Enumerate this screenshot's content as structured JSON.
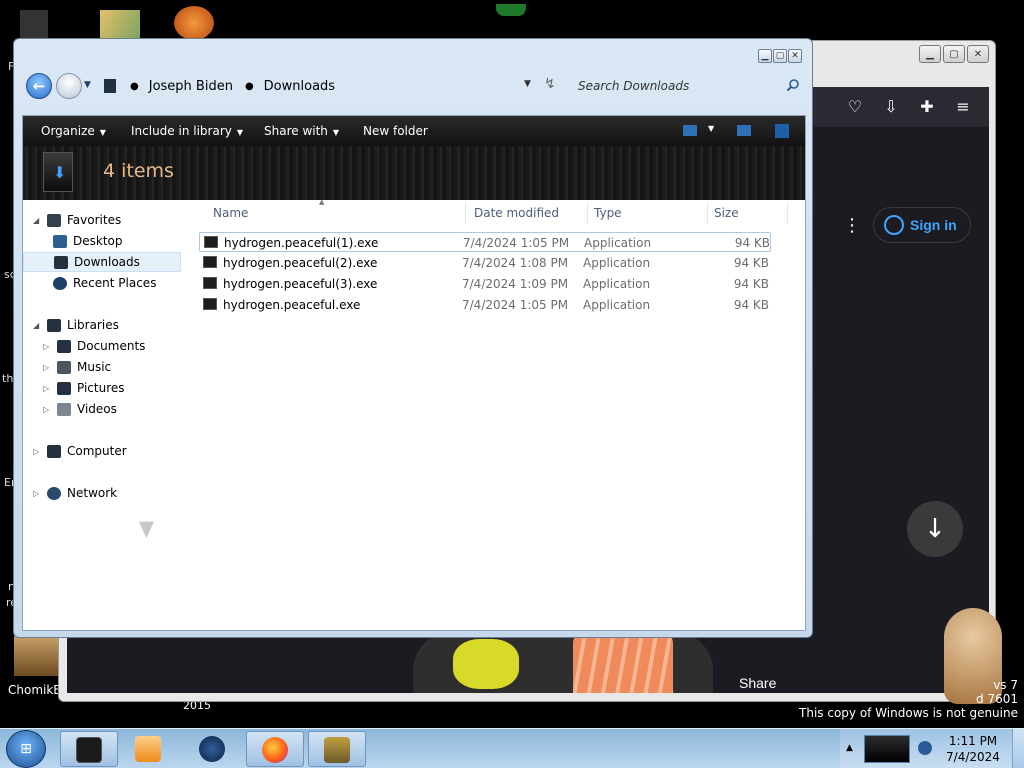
{
  "explorer": {
    "address": {
      "crumbs": [
        "Joseph Biden",
        "Downloads"
      ]
    },
    "search": {
      "placeholder": "Search Downloads"
    },
    "commands": {
      "organize": "Organize",
      "include": "Include in library",
      "share": "Share with",
      "new_folder": "New folder"
    },
    "details": {
      "count": "4 items"
    },
    "nav": {
      "favorites": "Favorites",
      "desktop": "Desktop",
      "downloads": "Downloads",
      "recent": "Recent Places",
      "libraries": "Libraries",
      "documents": "Documents",
      "music": "Music",
      "pictures": "Pictures",
      "videos": "Videos",
      "computer": "Computer",
      "network": "Network"
    },
    "columns": {
      "name": "Name",
      "date": "Date modified",
      "type": "Type",
      "size": "Size"
    },
    "files": [
      {
        "name": "hydrogen.peaceful(1).exe",
        "date": "7/4/2024 1:05 PM",
        "type": "Application",
        "size": "94 KB"
      },
      {
        "name": "hydrogen.peaceful(2).exe",
        "date": "7/4/2024 1:08 PM",
        "type": "Application",
        "size": "94 KB"
      },
      {
        "name": "hydrogen.peaceful(3).exe",
        "date": "7/4/2024 1:09 PM",
        "type": "Application",
        "size": "94 KB"
      },
      {
        "name": "hydrogen.peaceful.exe",
        "date": "7/4/2024 1:05 PM",
        "type": "Application",
        "size": "94 KB"
      }
    ]
  },
  "browser": {
    "sign_in": "Sign in",
    "share": "Share"
  },
  "desktop": {
    "icon_label": "ChomikB",
    "year": "2015",
    "watermark_line1": "vs 7",
    "watermark_line2": "d 7601",
    "watermark_line3": "This copy of Windows is not genuine",
    "frags": [
      "sc",
      "th",
      "Er",
      "n",
      "re",
      "F"
    ]
  },
  "taskbar": {
    "time": "1:11 PM",
    "date": "7/4/2024"
  },
  "colors": {
    "accent": "#3ea6ff",
    "count_text": "#e8b88a"
  },
  "icons": [
    "search-icon",
    "back-arrow-icon",
    "forward-arrow-icon",
    "refresh-icon",
    "folder-icon",
    "exe-file-icon",
    "download-icon",
    "pocket-icon",
    "extensions-icon",
    "hamburger-menu-icon",
    "windows-logo-icon",
    "firefox-icon"
  ]
}
